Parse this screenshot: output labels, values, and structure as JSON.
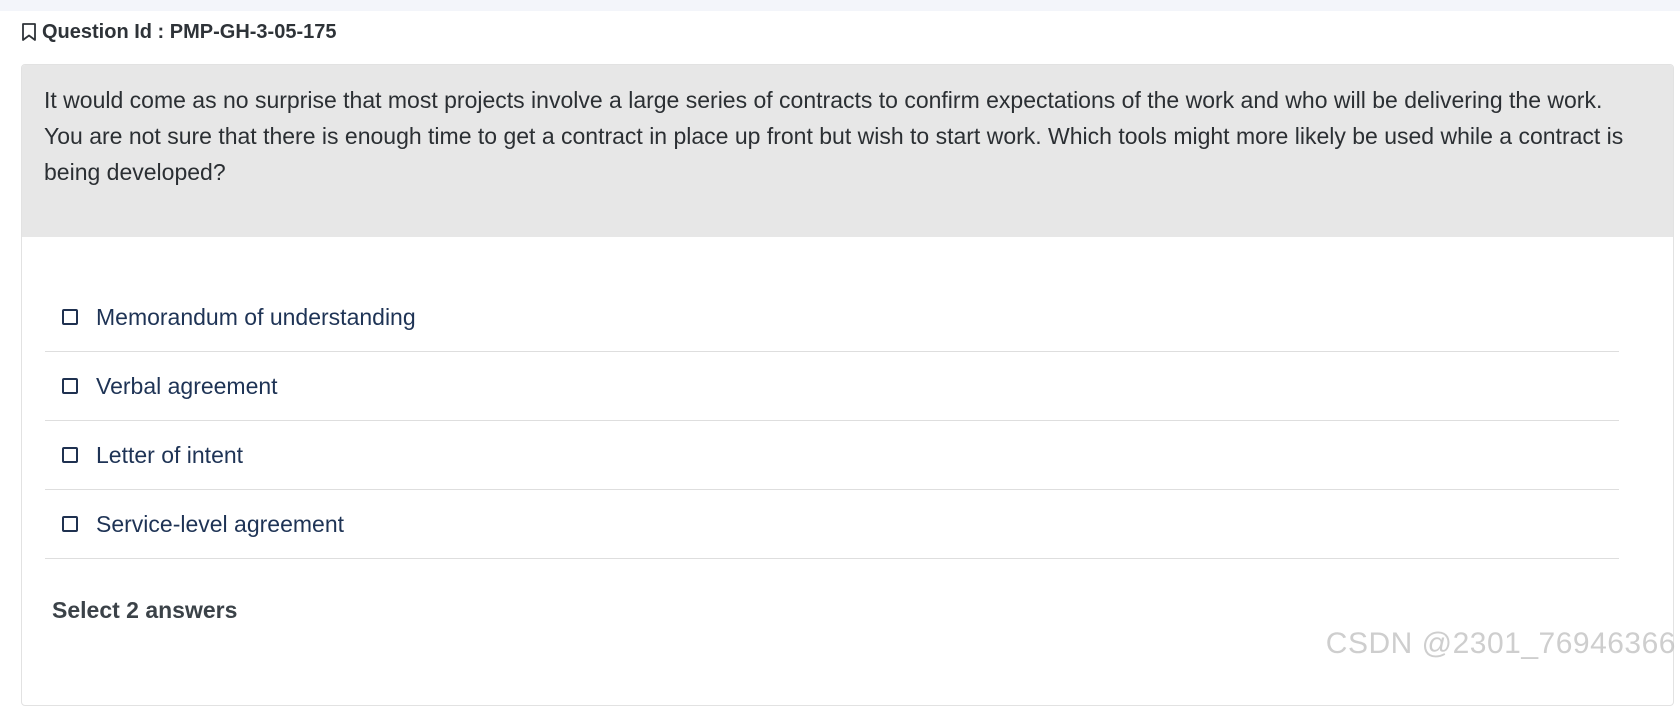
{
  "header": {
    "question_id_label": "Question Id : PMP-GH-3-05-175",
    "icon": "bookmark-icon"
  },
  "question": {
    "stem": "It would come as no surprise that most projects involve a large series of contracts to confirm expectations of the work and who will be delivering the work. You are not sure that there is enough time to get a contract in place up front but wish to start work. Which tools might more likely be used while a contract is being developed?"
  },
  "options": [
    {
      "label": "Memorandum of understanding",
      "checked": false
    },
    {
      "label": "Verbal agreement",
      "checked": false
    },
    {
      "label": "Letter of intent",
      "checked": false
    },
    {
      "label": "Service-level agreement",
      "checked": false
    }
  ],
  "instructions": {
    "select_hint": "Select 2 answers"
  },
  "watermark": {
    "text": "CSDN @2301_76946366"
  },
  "colors": {
    "stem_background": "#e7e7e7",
    "option_text": "#1e3355",
    "top_strip": "#f3f5fa"
  }
}
